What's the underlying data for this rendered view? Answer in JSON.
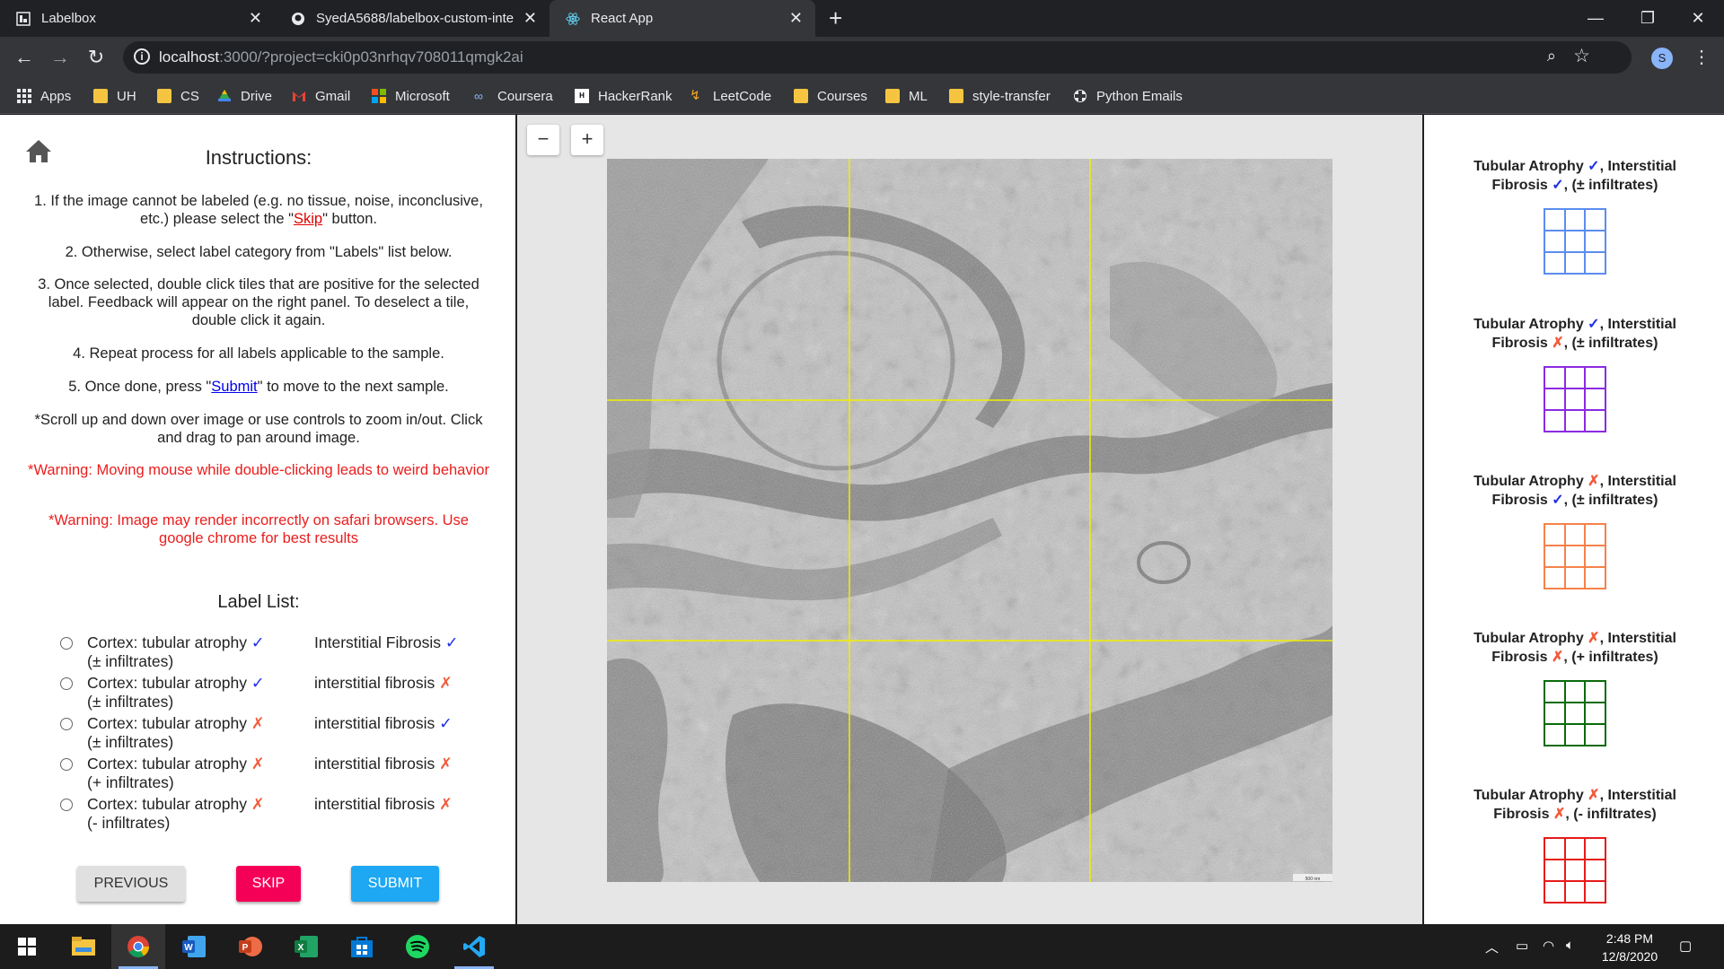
{
  "browser": {
    "tabs": [
      {
        "title": "Labelbox",
        "icon": "labelbox-icon"
      },
      {
        "title": "SyedA5688/labelbox-custom-inte",
        "icon": "github-icon"
      },
      {
        "title": "React App",
        "icon": "react-icon"
      }
    ],
    "url_host": "localhost",
    "url_rest": ":3000/?project=cki0p03nrhqv708011qmgk2ai",
    "avatar_letter": "S",
    "bookmarks": [
      {
        "label": "Apps",
        "icon": "apps-grid-icon"
      },
      {
        "label": "UH",
        "icon": "folder-icon"
      },
      {
        "label": "CS",
        "icon": "folder-icon"
      },
      {
        "label": "Drive",
        "icon": "drive-icon"
      },
      {
        "label": "Gmail",
        "icon": "gmail-icon"
      },
      {
        "label": "Microsoft",
        "icon": "microsoft-icon"
      },
      {
        "label": "Coursera",
        "icon": "coursera-icon"
      },
      {
        "label": "HackerRank",
        "icon": "hackerrank-icon"
      },
      {
        "label": "LeetCode",
        "icon": "leetcode-icon"
      },
      {
        "label": "Courses",
        "icon": "folder-icon"
      },
      {
        "label": "ML",
        "icon": "folder-icon"
      },
      {
        "label": "style-transfer",
        "icon": "folder-icon"
      },
      {
        "label": "Python Emails",
        "icon": "python-icon"
      }
    ]
  },
  "instructions": {
    "title": "Instructions:",
    "step1_pre": "1. If the image cannot be labeled (e.g. no tissue, noise, inconclusive, etc.) please select the \"",
    "step1_link": "Skip",
    "step1_post": "\" button.",
    "step2": "2. Otherwise, select label category from \"Labels\" list below.",
    "step3": "3. Once selected, double click tiles that are positive for the selected label. Feedback will appear on the right panel. To deselect a tile, double click it again.",
    "step4": "4. Repeat process for all labels applicable to the sample.",
    "step5_pre": "5. Once done, press \"",
    "step5_link": "Submit",
    "step5_post": "\" to move to the next sample.",
    "note": "*Scroll up and down over image or use controls to zoom in/out. Click and drag to pan around image.",
    "warning1": "*Warning: Moving mouse while double-clicking leads to weird behavior",
    "warning2": "*Warning: Image may render incorrectly on safari browsers. Use google chrome for best results"
  },
  "label_list": {
    "title": "Label List:",
    "items": [
      {
        "left": "Cortex: tubular atrophy",
        "left_mark": "✓",
        "left_sub": "(± infiltrates)",
        "right": "Interstitial Fibrosis",
        "right_mark": "✓"
      },
      {
        "left": "Cortex: tubular atrophy",
        "left_mark": "✓",
        "left_sub": "(± infiltrates)",
        "right": "interstitial fibrosis",
        "right_mark": "✗"
      },
      {
        "left": "Cortex: tubular atrophy",
        "left_mark": "✗",
        "left_sub": "(± infiltrates)",
        "right": "interstitial fibrosis",
        "right_mark": "✓"
      },
      {
        "left": "Cortex: tubular atrophy",
        "left_mark": "✗",
        "left_sub": "(+ infiltrates)",
        "right": "interstitial fibrosis",
        "right_mark": "✗"
      },
      {
        "left": "Cortex: tubular atrophy",
        "left_mark": "✗",
        "left_sub": "(- infiltrates)",
        "right": "interstitial fibrosis",
        "right_mark": "✗"
      }
    ]
  },
  "buttons": {
    "previous": "PREVIOUS",
    "skip": "SKIP",
    "submit": "SUBMIT"
  },
  "viewer": {
    "zoom_out": "−",
    "zoom_in": "+",
    "scale_bar": "500 nm"
  },
  "feedback": [
    {
      "l1a": "Tubular Atrophy ",
      "m1": "✓",
      "l1b": ", Interstitial",
      "l2a": "Fibrosis ",
      "m2": "✓",
      "l2b": ", (± infiltrates)",
      "color": "#5b8def"
    },
    {
      "l1a": "Tubular Atrophy ",
      "m1": "✓",
      "l1b": ", Interstitial",
      "l2a": "Fibrosis ",
      "m2": "✗",
      "l2b": ", (± infiltrates)",
      "color": "#8b2be2"
    },
    {
      "l1a": "Tubular Atrophy ",
      "m1": "✗",
      "l1b": ", Interstitial",
      "l2a": "Fibrosis ",
      "m2": "✓",
      "l2b": ", (± infiltrates)",
      "color": "#f5824b"
    },
    {
      "l1a": "Tubular Atrophy ",
      "m1": "✗",
      "l1b": ", Interstitial",
      "l2a": "Fibrosis ",
      "m2": "✗",
      "l2b": ", (+ infiltrates)",
      "color": "#0a6b0a"
    },
    {
      "l1a": "Tubular Atrophy ",
      "m1": "✗",
      "l1b": ", Interstitial",
      "l2a": "Fibrosis ",
      "m2": "✗",
      "l2b": ", (- infiltrates)",
      "color": "#e81a1a"
    }
  ],
  "taskbar": {
    "apps": [
      "windows-start-icon",
      "file-explorer-icon",
      "chrome-icon",
      "word-icon",
      "powerpoint-icon",
      "excel-icon",
      "store-icon",
      "spotify-icon",
      "vscode-icon"
    ],
    "time": "2:48 PM",
    "date": "12/8/2020"
  }
}
